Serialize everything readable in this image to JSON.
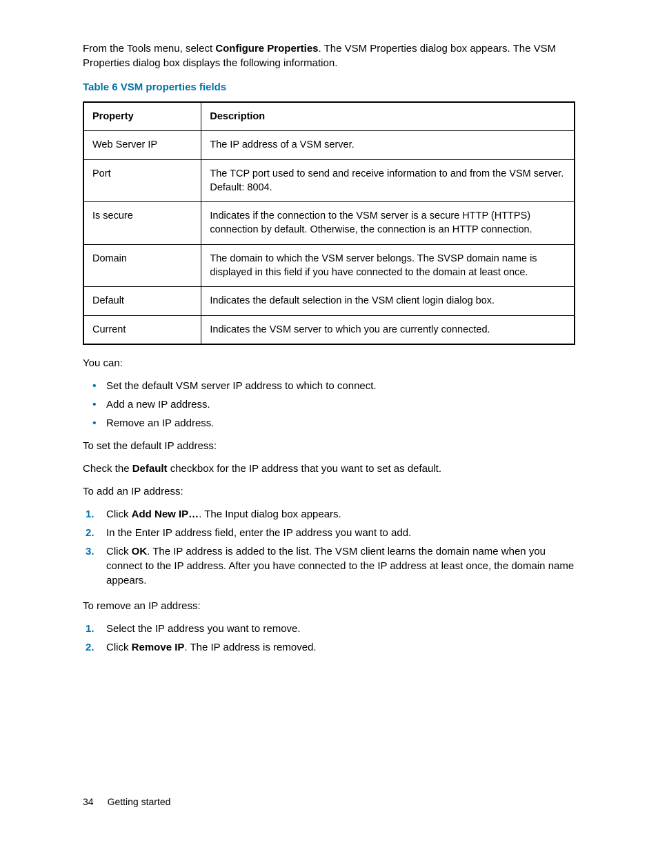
{
  "intro": {
    "pre": "From the Tools menu, select ",
    "bold": "Configure Properties",
    "post": ". The VSM Properties dialog box appears. The VSM Properties dialog box displays the following information."
  },
  "table": {
    "caption": "Table 6 VSM properties fields",
    "headers": {
      "property": "Property",
      "description": "Description"
    },
    "rows": [
      {
        "property": "Web Server IP",
        "description": "The IP address of a VSM server."
      },
      {
        "property": "Port",
        "description": "The TCP port used to send and receive information to and from the VSM server. Default: 8004."
      },
      {
        "property": "Is secure",
        "description": "Indicates if the connection to the VSM server is a secure HTTP (HTTPS) connection by default. Otherwise, the connection is an HTTP connection."
      },
      {
        "property": "Domain",
        "description": "The domain to which the VSM server belongs. The SVSP domain name is displayed in this field if you have connected to the domain at least once."
      },
      {
        "property": "Default",
        "description": "Indicates the default selection in the VSM client login dialog box."
      },
      {
        "property": "Current",
        "description": "Indicates the VSM server to which you are currently connected."
      }
    ]
  },
  "youcan": "You can:",
  "bullets": [
    "Set the default VSM server IP address to which to connect.",
    "Add a new IP address.",
    "Remove an IP address."
  ],
  "setDefault": {
    "heading": "To set the default IP address:",
    "text_pre": "Check the ",
    "text_bold": "Default",
    "text_post": " checkbox for the IP address that you want to set as default."
  },
  "addIP": {
    "heading": "To add an IP address:",
    "steps": [
      {
        "pre": "Click ",
        "bold": "Add New IP…",
        "post": ". The Input dialog box appears."
      },
      {
        "pre": "In the Enter IP address field, enter the IP address you want to add.",
        "bold": "",
        "post": ""
      },
      {
        "pre": "Click ",
        "bold": "OK",
        "post": ". The IP address is added to the list. The VSM client learns the domain name when you connect to the IP address. After you have connected to the IP address at least once, the domain name appears."
      }
    ]
  },
  "removeIP": {
    "heading": "To remove an IP address:",
    "steps": [
      {
        "pre": "Select the IP address you want to remove.",
        "bold": "",
        "post": ""
      },
      {
        "pre": "Click ",
        "bold": "Remove IP",
        "post": ". The IP address is removed."
      }
    ]
  },
  "footer": {
    "page": "34",
    "section": "Getting started"
  }
}
